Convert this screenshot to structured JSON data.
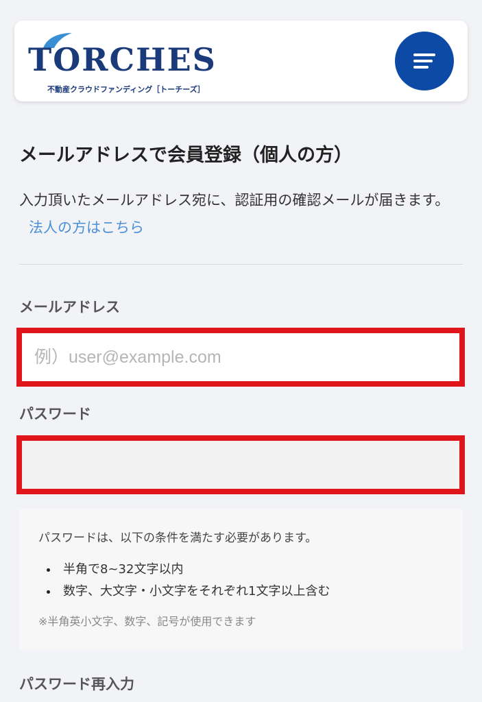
{
  "header": {
    "logo_text": "TORCHES",
    "logo_subtitle": "不動産クラウドファンディング［トーチーズ］",
    "menu_icon": "menu-icon"
  },
  "colors": {
    "brand": "#1b3a7a",
    "menu_button": "#0c4aa6",
    "link": "#4a90d9",
    "highlight_border": "#e0141b"
  },
  "page": {
    "title": "メールアドレスで会員登録（個人の方）",
    "intro": "入力頂いたメールアドレス宛に、認証用の確認メールが届きます。",
    "corporate_link": "法人の方はこちら"
  },
  "form": {
    "email_label": "メールアドレス",
    "email_placeholder": "例）user@example.com",
    "email_value": "",
    "password_label": "パスワード",
    "password_value": "",
    "password_confirm_label": "パスワード再入力"
  },
  "conditions": {
    "title": "パスワードは、以下の条件を満たす必要があります。",
    "items": [
      "半角で8~32文字以内",
      "数字、大文字・小文字をそれぞれ1文字以上含む"
    ],
    "note": "※半角英小文字、数字、記号が使用できます"
  }
}
